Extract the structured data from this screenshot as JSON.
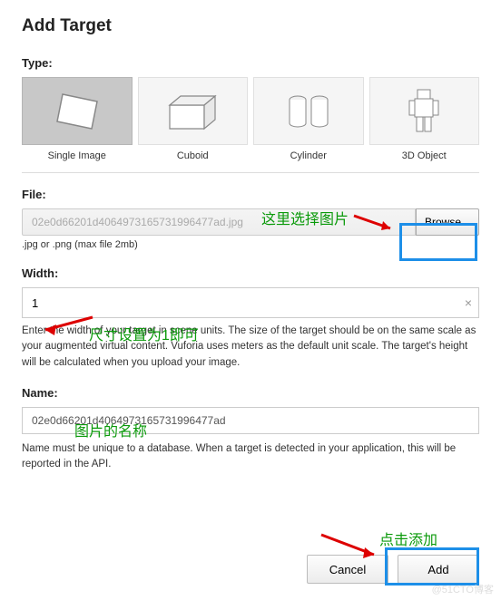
{
  "title": "Add Target",
  "type": {
    "label": "Type:",
    "options": [
      {
        "name": "Single Image",
        "selected": true
      },
      {
        "name": "Cuboid",
        "selected": false
      },
      {
        "name": "Cylinder",
        "selected": false
      },
      {
        "name": "3D Object",
        "selected": false
      }
    ]
  },
  "file": {
    "label": "File:",
    "value": "02e0d66201d4064973165731996477ad.jpg",
    "browse": "Browse...",
    "hint": ".jpg or .png (max file 2mb)"
  },
  "width": {
    "label": "Width:",
    "value": "1",
    "desc": "Enter the width of your target in scene units. The size of the target should be on the same scale as your augmented virtual content. Vuforia uses meters as the default unit scale. The target's height will be calculated when you upload your image."
  },
  "name": {
    "label": "Name:",
    "value": "02e0d66201d4064973165731996477ad",
    "desc": "Name must be unique to a database. When a target is detected in your application, this will be reported in the API."
  },
  "buttons": {
    "cancel": "Cancel",
    "add": "Add"
  },
  "annotations": {
    "a1": "这里选择图片",
    "a2": "尺寸设置为1即可",
    "a3": "图片的名称",
    "a4": "点击添加"
  },
  "watermark": "@51CTO博客"
}
